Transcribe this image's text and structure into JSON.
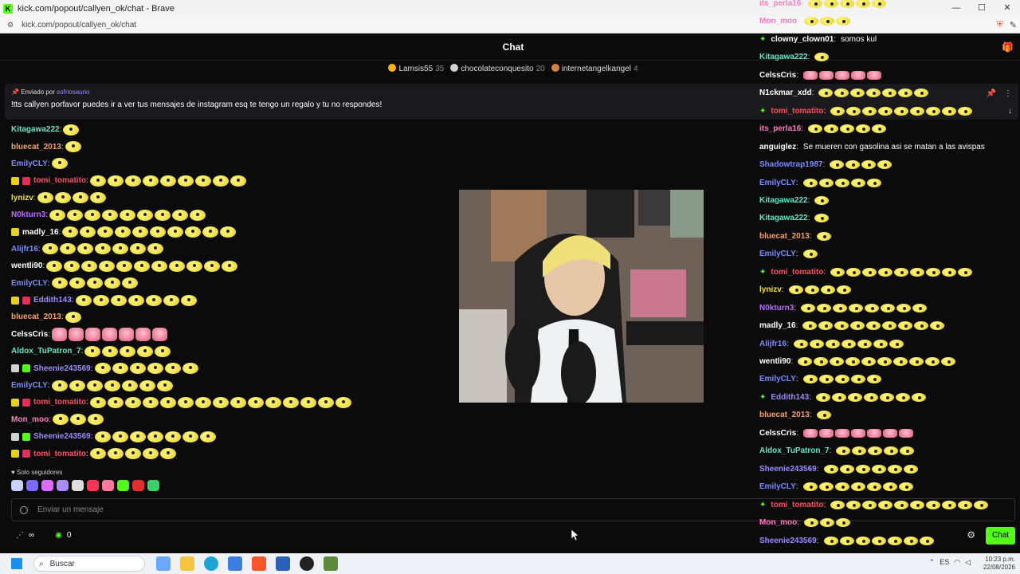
{
  "browser": {
    "window_title": "kick.com/popout/callyen_ok/chat - Brave",
    "url": "kick.com/popout/callyen_ok/chat",
    "window_controls": [
      "—",
      "☐",
      "✕"
    ]
  },
  "chat": {
    "header_title": "Chat",
    "leaderboard": [
      {
        "user": "Lamsis55",
        "count": "35",
        "color": "#f5b50a"
      },
      {
        "user": "chocolateconquesito",
        "count": "20",
        "color": "#cfd3d6"
      },
      {
        "user": "internetangelkangel",
        "count": "4",
        "color": "#d9813a"
      }
    ],
    "pinned": {
      "prefix": "Enviado por",
      "user": "sofriosaurio",
      "message": "!tts callyen porfavor puedes ir a ver tus mensajes de instagram esq te tengo un regalo y tu no respondes!"
    },
    "messages": [
      {
        "user": "Kitagawa222",
        "color": "#69e3c6",
        "emotes": 1,
        "badges": []
      },
      {
        "user": "bluecat_2013",
        "color": "#f6a06a",
        "emotes": 1,
        "badges": []
      },
      {
        "user": "EmilyCLY",
        "color": "#7b8cff",
        "emotes": 1,
        "badges": []
      },
      {
        "user": "tomi_tomatito",
        "color": "#ff4d5e",
        "emotes": 9,
        "badges": [
          "#e8d21c",
          "#e0305a"
        ]
      },
      {
        "user": "lynizv",
        "color": "#f0e22f",
        "emotes": 4,
        "badges": []
      },
      {
        "user": "N0kturn3",
        "color": "#b86bff",
        "emotes": 9,
        "badges": []
      },
      {
        "user": "madly_16",
        "color": "#ffffff",
        "emotes": 10,
        "badges": [
          "#e8d21c"
        ]
      },
      {
        "user": "Alijfr16",
        "color": "#7b8cff",
        "emotes": 7,
        "badges": []
      },
      {
        "user": "wentli90",
        "color": "#ffffff",
        "emotes": 11,
        "badges": []
      },
      {
        "user": "EmilyCLY",
        "color": "#7b8cff",
        "emotes": 5,
        "badges": []
      },
      {
        "user": "Eddith143",
        "color": "#9b8cff",
        "emotes": 7,
        "badges": [
          "#e8d21c",
          "#e0305a"
        ]
      },
      {
        "user": "bluecat_2013",
        "color": "#f6a06a",
        "emotes": 1,
        "badges": []
      },
      {
        "user": "CelssCris",
        "color": "#ffffff",
        "emotes": 7,
        "pink": true,
        "badges": []
      },
      {
        "user": "Aldox_TuPatron_7",
        "color": "#69e3c6",
        "emotes": 5,
        "badges": []
      },
      {
        "user": "Sheenie243569",
        "color": "#9b8cff",
        "emotes": 6,
        "badges": [
          "#cfd3d6",
          "#53fc18"
        ]
      },
      {
        "user": "EmilyCLY",
        "color": "#7b8cff",
        "emotes": 7,
        "badges": []
      },
      {
        "user": "tomi_tomatito",
        "color": "#ff4d5e",
        "emotes": 15,
        "badges": [
          "#e8d21c",
          "#e0305a"
        ]
      },
      {
        "user": "Mon_moo",
        "color": "#ff7ac4",
        "emotes": 3,
        "badges": []
      },
      {
        "user": "Sheenie243569",
        "color": "#9b8cff",
        "emotes": 7,
        "badges": [
          "#cfd3d6",
          "#53fc18"
        ]
      },
      {
        "user": "tomi_tomatito",
        "color": "#ff4d5e",
        "emotes": 5,
        "badges": [
          "#e8d21c",
          "#e0305a"
        ]
      }
    ],
    "followers_only": "Solo seguidores",
    "input_placeholder": "Enviar un mensaje",
    "viewers_count": "0",
    "send_button": "Chat"
  },
  "overlay_chat": {
    "rows": [
      {
        "user": "its_perla16",
        "color": "#ff7ac4",
        "emotes": 5
      },
      {
        "user": "Mon_moo",
        "color": "#ff7ac4",
        "emotes": 3
      },
      {
        "user": "clowny_clown01",
        "color": "#ffffff",
        "text": "somos kul",
        "star": true
      },
      {
        "user": "Kitagawa222",
        "color": "#69e3c6",
        "emotes": 1
      },
      {
        "user": "CelssCris",
        "color": "#ffffff",
        "emotes": 5,
        "pink": true
      },
      {
        "user": "N1ckmar_xdd",
        "color": "#ffffff",
        "emotes": 7
      },
      {
        "user": "tomi_tomatito",
        "color": "#ff4d5e",
        "emotes": 9,
        "star": true
      },
      {
        "user": "its_perla16",
        "color": "#ff7ac4",
        "emotes": 5
      },
      {
        "user": "anguiglez",
        "color": "#ffffff",
        "text": "Se mueren con gasolina asi se matan a las avispas"
      },
      {
        "user": "Shadowtrap1987",
        "color": "#7b8cff",
        "emotes": 4
      },
      {
        "user": "EmilyCLY",
        "color": "#7b8cff",
        "emotes": 5
      },
      {
        "user": "Kitagawa222",
        "color": "#69e3c6",
        "emotes": 1
      },
      {
        "user": "Kitagawa222",
        "color": "#69e3c6",
        "emotes": 1
      },
      {
        "user": "bluecat_2013",
        "color": "#f6a06a",
        "emotes": 1
      },
      {
        "user": "EmilyCLY",
        "color": "#7b8cff",
        "emotes": 1
      },
      {
        "user": "tomi_tomatito",
        "color": "#ff4d5e",
        "emotes": 9,
        "star": true
      },
      {
        "user": "lynizv",
        "color": "#f0e22f",
        "emotes": 4
      },
      {
        "user": "N0kturn3",
        "color": "#b86bff",
        "emotes": 8
      },
      {
        "user": "madly_16",
        "color": "#ffffff",
        "emotes": 9
      },
      {
        "user": "Alijfr16",
        "color": "#7b8cff",
        "emotes": 7
      },
      {
        "user": "wentli90",
        "color": "#ffffff",
        "emotes": 10
      },
      {
        "user": "EmilyCLY",
        "color": "#7b8cff",
        "emotes": 5
      },
      {
        "user": "Eddith143",
        "color": "#9b8cff",
        "emotes": 7,
        "star": true
      },
      {
        "user": "bluecat_2013",
        "color": "#f6a06a",
        "emotes": 1
      },
      {
        "user": "CelssCris",
        "color": "#ffffff",
        "emotes": 7,
        "pink": true
      },
      {
        "user": "Aldox_TuPatron_7",
        "color": "#69e3c6",
        "emotes": 5
      },
      {
        "user": "Sheenie243569",
        "color": "#9b8cff",
        "emotes": 6
      },
      {
        "user": "EmilyCLY",
        "color": "#7b8cff",
        "emotes": 7
      },
      {
        "user": "tomi_tomatito",
        "color": "#ff4d5e",
        "emotes": 10,
        "star": true
      },
      {
        "user": "Mon_moo",
        "color": "#ff7ac4",
        "emotes": 3
      },
      {
        "user": "Sheenie243569",
        "color": "#9b8cff",
        "emotes": 7
      }
    ]
  },
  "taskbar": {
    "search_label": "Buscar",
    "lang": "ES",
    "time": "10:23 p.m.",
    "date": "22/08/2026"
  }
}
